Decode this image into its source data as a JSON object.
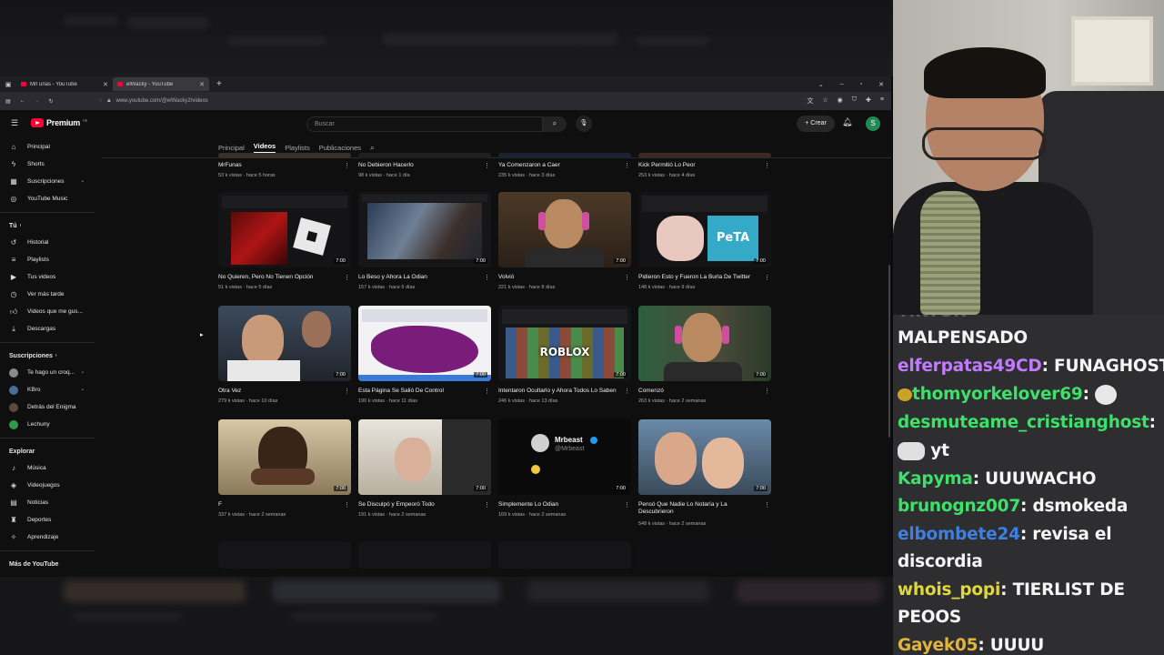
{
  "browser": {
    "tabs": [
      {
        "title": "Mrl unas - YouTube",
        "active": false
      },
      {
        "title": "elWacky - YouTube",
        "active": true
      }
    ],
    "url": "www.youtube.com/@elWacky2/videos"
  },
  "youtube": {
    "logo": "Premium",
    "logo_cc": "PE",
    "search_placeholder": "Buscar",
    "create_label": "Crear",
    "avatar_letter": "S",
    "sidebar": {
      "main": [
        {
          "label": "Principal",
          "icon": "home-icon"
        },
        {
          "label": "Shorts",
          "icon": "shorts-icon"
        },
        {
          "label": "Suscripciones",
          "icon": "subscriptions-icon"
        },
        {
          "label": "YouTube Music",
          "icon": "music-icon"
        }
      ],
      "you_header": "Tú",
      "you": [
        {
          "label": "Historial",
          "icon": "history-icon"
        },
        {
          "label": "Playlists",
          "icon": "playlists-icon"
        },
        {
          "label": "Tus videos",
          "icon": "your-videos-icon"
        },
        {
          "label": "Ver más tarde",
          "icon": "watch-later-icon"
        },
        {
          "label": "Videos que me gus...",
          "icon": "like-icon"
        },
        {
          "label": "Descargas",
          "icon": "download-icon"
        }
      ],
      "subs_header": "Suscripciones",
      "subs": [
        {
          "label": "Te hago un croq...",
          "color": "#8a8a8a"
        },
        {
          "label": "KBro",
          "color": "#4b6b9a"
        },
        {
          "label": "Detrás del Enigma",
          "color": "#5a4a3a"
        },
        {
          "label": "Lechuny",
          "color": "#2e9a4e"
        }
      ],
      "explore_header": "Explorar",
      "explore": [
        {
          "label": "Música",
          "icon": "music-note-icon"
        },
        {
          "label": "Videojuegos",
          "icon": "gamepad-icon"
        },
        {
          "label": "Noticias",
          "icon": "news-icon"
        },
        {
          "label": "Deportes",
          "icon": "trophy-icon"
        },
        {
          "label": "Aprendizaje",
          "icon": "bulb-icon"
        }
      ],
      "more_header": "Más de YouTube"
    },
    "channel_tabs": [
      "Principal",
      "Videos",
      "Playlists",
      "Publicaciones"
    ],
    "active_tab": "Videos",
    "top_row": [
      {
        "title": "MrFunas",
        "meta": "53 k vistas · hace 5 horas"
      },
      {
        "title": "No Debieron Hacerlo",
        "meta": "98 k vistas · hace 1 día"
      },
      {
        "title": "Ya Comenzaron a Caer",
        "meta": "235 k vistas · hace 3 días"
      },
      {
        "title": "Kick Permitió Lo Peor",
        "meta": "253 k vistas · hace 4 días"
      }
    ],
    "videos": [
      {
        "title": "No Quieren, Pero No Tienen Opción",
        "meta": "51 k vistas · hace 5 días",
        "duration": "7:00"
      },
      {
        "title": "Lo Beso y Ahora La Odian",
        "meta": "157 k vistas · hace 6 días",
        "duration": "7:00"
      },
      {
        "title": "Volvió",
        "meta": "221 k vistas · hace 8 días",
        "duration": "7:00"
      },
      {
        "title": "Pidieron Esto y Fueron La Burla De Twitter",
        "meta": "148 k vistas · hace 9 días",
        "duration": "7:00"
      },
      {
        "title": "Otra Vez",
        "meta": "279 k vistas · hace 10 días",
        "duration": "7:00"
      },
      {
        "title": "Esta Página Se Salió De Control",
        "meta": "190 k vistas · hace 11 días",
        "duration": "7:00"
      },
      {
        "title": "Intentaron Ocultarlo y Ahora Todos Lo Saben",
        "meta": "246 k vistas · hace 13 días",
        "duration": "7:00"
      },
      {
        "title": "Comenzó",
        "meta": "263 k vistas · hace 2 semanas",
        "duration": "7:00"
      },
      {
        "title": "F",
        "meta": "337 k vistas · hace 2 semanas",
        "duration": "7:00"
      },
      {
        "title": "Se Disculpó y Empeoró Todo",
        "meta": "191 k vistas · hace 2 semanas",
        "duration": "7:00"
      },
      {
        "title": "Simplemente Lo Odian",
        "meta": "169 k vistas · hace 2 semanas",
        "duration": "7:00"
      },
      {
        "title": "Pensó Que Nadie Lo Notaría y La Descubrieron",
        "meta": "548 k vistas · hace 2 semanas",
        "duration": "7:00"
      }
    ],
    "thumb_text": {
      "roblox": "ROBLOX",
      "peta": "PeTA",
      "mrbeast_name": "Mrbeast",
      "mrbeast_handle": "@Mrbeast"
    }
  },
  "chat": [
    {
      "user": "",
      "text": "MALPENSADO",
      "color": "#f5f5f5"
    },
    {
      "user": "elferpatas49CD",
      "text": ": FUNAGHOST",
      "color": "#c27bff"
    },
    {
      "user": "thomyorkelover69",
      "text": ": ",
      "color": "#3ee06a",
      "emote": true
    },
    {
      "user": "desmuteame_cristianghost",
      "text": ":",
      "color": "#3ee06a"
    },
    {
      "user": "",
      "text": " yt",
      "color": "#f5f5f5",
      "emote": true
    },
    {
      "user": "Kapyma",
      "text": ": UUUWACHO",
      "color": "#3ee06a"
    },
    {
      "user": "brunognz007",
      "text": ": dsmokeda",
      "color": "#3ee06a"
    },
    {
      "user": "elbombete24",
      "text": ": revisa el",
      "color": "#3f7fe0"
    },
    {
      "user": "",
      "text": "discordia",
      "color": "#f5f5f5"
    },
    {
      "user": "whois_popi",
      "text": ": TIERLIST DE",
      "color": "#e0d63e"
    },
    {
      "user": "",
      "text": "PEOOS",
      "color": "#f5f5f5"
    },
    {
      "user": "Gayek05",
      "text": ": UUUU",
      "color": "#e0b43e"
    }
  ]
}
